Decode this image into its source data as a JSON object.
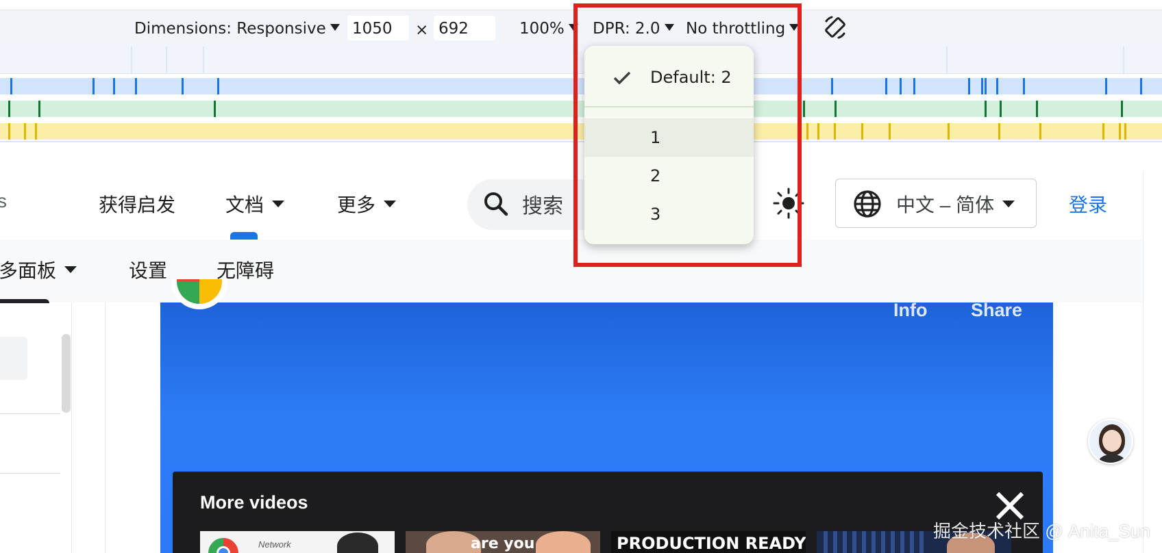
{
  "toolbar": {
    "dimensions_label": "Dimensions: Responsive",
    "width_value": "1050",
    "times_sign": "×",
    "height_value": "692",
    "zoom_label": "100%",
    "dpr_label": "DPR: 2.0",
    "throttling_label": "No throttling",
    "rotate_icon": "rotate-icon"
  },
  "dpr_menu": {
    "items": [
      {
        "label": "Default: 2",
        "checked": true
      },
      {
        "label": "1",
        "hovered": true
      },
      {
        "label": "2"
      },
      {
        "label": "3"
      }
    ]
  },
  "page_nav": {
    "partial_left": "s",
    "items": [
      {
        "label": "获得启发"
      },
      {
        "label": "文档",
        "active": true,
        "has_dropdown": true
      },
      {
        "label": "更多",
        "has_dropdown": true
      }
    ],
    "search_label": "搜索",
    "language_label": "中文 – 简体",
    "login_label": "登录"
  },
  "sub_nav": {
    "items": [
      {
        "label": "多面板",
        "has_dropdown": true
      },
      {
        "label": "设置"
      },
      {
        "label": "无障碍"
      }
    ]
  },
  "video": {
    "info_label": "Info",
    "share_label": "Share",
    "more_videos_title": "More videos",
    "thumb_network_text": "Network",
    "thumb_are_you_text": "are you",
    "thumb_production_text": "PRODUCTION READY"
  },
  "watermark": "掘金技术社区 @ Anita_Sun",
  "colors": {
    "highlight": "#e0201d",
    "accent": "#1a73e8",
    "video_blue": "#2b7bf8"
  }
}
